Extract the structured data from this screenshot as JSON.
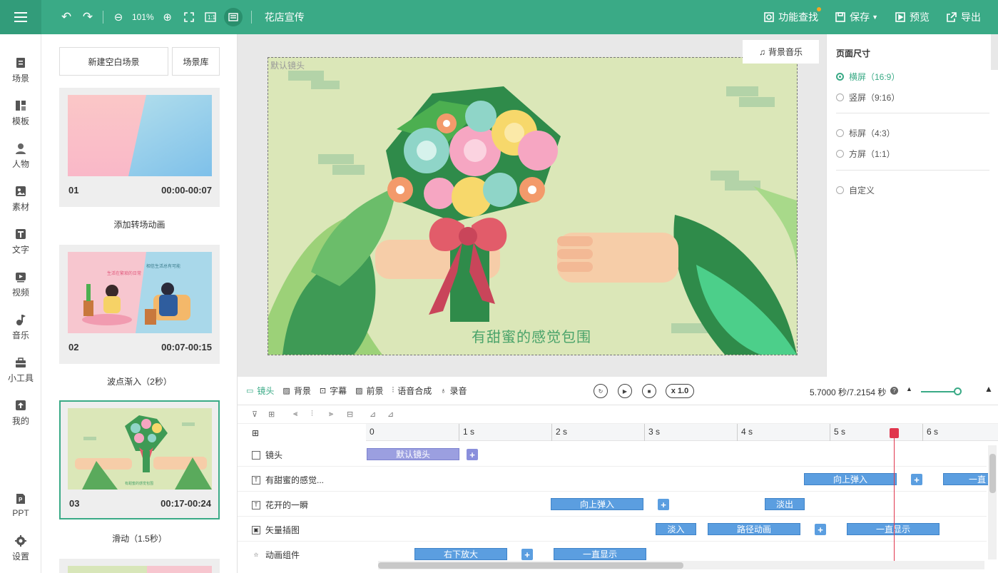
{
  "topbar": {
    "zoom": "101%",
    "title": "花店宣传",
    "find_label": "功能查找",
    "save_label": "保存",
    "preview_label": "预览",
    "export_label": "导出"
  },
  "leftnav": [
    {
      "label": "场景",
      "icon": "scene-icon"
    },
    {
      "label": "模板",
      "icon": "template-icon"
    },
    {
      "label": "人物",
      "icon": "person-icon"
    },
    {
      "label": "素材",
      "icon": "material-icon"
    },
    {
      "label": "文字",
      "icon": "text-icon"
    },
    {
      "label": "视频",
      "icon": "video-icon"
    },
    {
      "label": "音乐",
      "icon": "music-icon"
    },
    {
      "label": "小工具",
      "icon": "toolbox-icon"
    },
    {
      "label": "我的",
      "icon": "upload-icon"
    },
    {
      "label": "PPT",
      "icon": "ppt-icon"
    },
    {
      "label": "设置",
      "icon": "gear-icon"
    }
  ],
  "scenes": {
    "new_blank": "新建空白场景",
    "library": "场景库",
    "items": [
      {
        "num": "01",
        "time": "00:00-00:07",
        "transition": "添加转场动画"
      },
      {
        "num": "02",
        "time": "00:07-00:15",
        "transition": "波点渐入（2秒）"
      },
      {
        "num": "03",
        "time": "00:17-00:24",
        "transition": "滑动（1.5秒）"
      }
    ]
  },
  "canvas": {
    "bg_music": "背景音乐",
    "stage_label": "默认镜头",
    "caption": "有甜蜜的感觉包围"
  },
  "page_size": {
    "title": "页面尺寸",
    "options": [
      "横屏（16:9）",
      "竖屏（9:16）",
      "标屏（4:3）",
      "方屏（1:1）",
      "自定义"
    ],
    "selected": "横屏（16:9）"
  },
  "timeline": {
    "tabs": [
      "镜头",
      "背景",
      "字幕",
      "前景",
      "语音合成",
      "录音"
    ],
    "speed": "x 1.0",
    "time": "5.7000 秒/7.2154 秒",
    "ticks": [
      "0",
      "1 s",
      "2 s",
      "3 s",
      "4 s",
      "5 s",
      "6 s"
    ],
    "tracks": [
      {
        "name": "镜头"
      },
      {
        "name": "有甜蜜的感觉..."
      },
      {
        "name": "花开的一瞬"
      },
      {
        "name": "矢量插图"
      },
      {
        "name": "动画组件"
      }
    ],
    "clips": {
      "default_shot": "默认镜头",
      "t2_a": "向上弹入",
      "t2_b": "一直",
      "t3_a": "向上弹入",
      "t3_b": "淡出",
      "t4_a": "淡入",
      "t4_b": "路径动画",
      "t4_c": "一直显示",
      "t5_a": "右下放大",
      "t5_b": "一直显示"
    }
  },
  "colors": {
    "brand": "#3aaa86",
    "clip_blue": "#5b9ee0",
    "clip_purple": "#9b9fe0",
    "playhead": "#e0364d"
  }
}
